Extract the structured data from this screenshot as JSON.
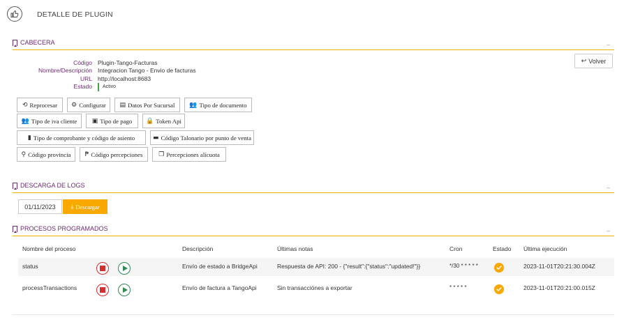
{
  "header": {
    "title": "DETALLE DE PLUGIN",
    "logo_icon": "thumbs-up-icon"
  },
  "cabecera": {
    "title": "CABECERA",
    "collapse_label": "–",
    "fields": [
      {
        "label": "Código",
        "value": "Plugin-Tango-Facturas"
      },
      {
        "label": "Nombre/Descripción",
        "value": "Integracion Tango - Envio de facturas"
      },
      {
        "label": "URL",
        "value": "http://localhost:8683"
      },
      {
        "label": "Estado",
        "value": "Activo"
      }
    ],
    "volver_label": "Volver",
    "buttons": [
      {
        "label": "Reprocesar",
        "icon": "refresh-icon"
      },
      {
        "label": "Configurar",
        "icon": "gear-icon"
      },
      {
        "label": "Datos Por Sucursal",
        "icon": "document-icon"
      },
      {
        "label": "Tipo de documento",
        "icon": "users-icon"
      },
      {
        "label": "Tipo de iva cliente",
        "icon": "users-icon"
      },
      {
        "label": "Tipo de pago",
        "icon": "money-icon"
      },
      {
        "label": "Token Api",
        "icon": "lock-icon"
      },
      {
        "label": "Tipo de comprobante y código de asiento",
        "icon": "file-icon"
      },
      {
        "label": "Código Talonario por punto de venta",
        "icon": "card-icon"
      },
      {
        "label": "Código provincia",
        "icon": "map-marker-icon"
      },
      {
        "label": "Código percepciones",
        "icon": "percent-icon"
      },
      {
        "label": "Percepciones alícuota",
        "icon": "copy-icon"
      }
    ]
  },
  "logs": {
    "title": "DESCARGA DE LOGS",
    "collapse_label": "–",
    "date_value": "01/11/2023",
    "download_label": "Descargar"
  },
  "procesos": {
    "title": "PROCESOS PROGRAMADOS",
    "collapse_label": "–",
    "columns": [
      "Nombre del proceso",
      "Descripción",
      "Últimas notas",
      "Cron",
      "Estado",
      "Última ejecución"
    ],
    "rows": [
      {
        "name": "status",
        "description": "Envío de estado a BridgeApi",
        "notes": "Respuesta de API: 200 - {\"result\":{\"status\":\"updated!\"}}",
        "cron": "*/30 * * * * *",
        "last_run": "2023-11-01T20:21:30.004Z"
      },
      {
        "name": "processTransactions",
        "description": "Envío de factura a TangoApi",
        "notes": "Sin transacciónes a exportar",
        "cron": "* * * * *",
        "last_run": "2023-11-01T20:21:00.015Z"
      }
    ]
  },
  "colors": {
    "accent": "#f7a900",
    "section_title": "#6b2c6e",
    "stop": "#d32f2f",
    "play": "#2e8b57",
    "active": "#43a047"
  }
}
